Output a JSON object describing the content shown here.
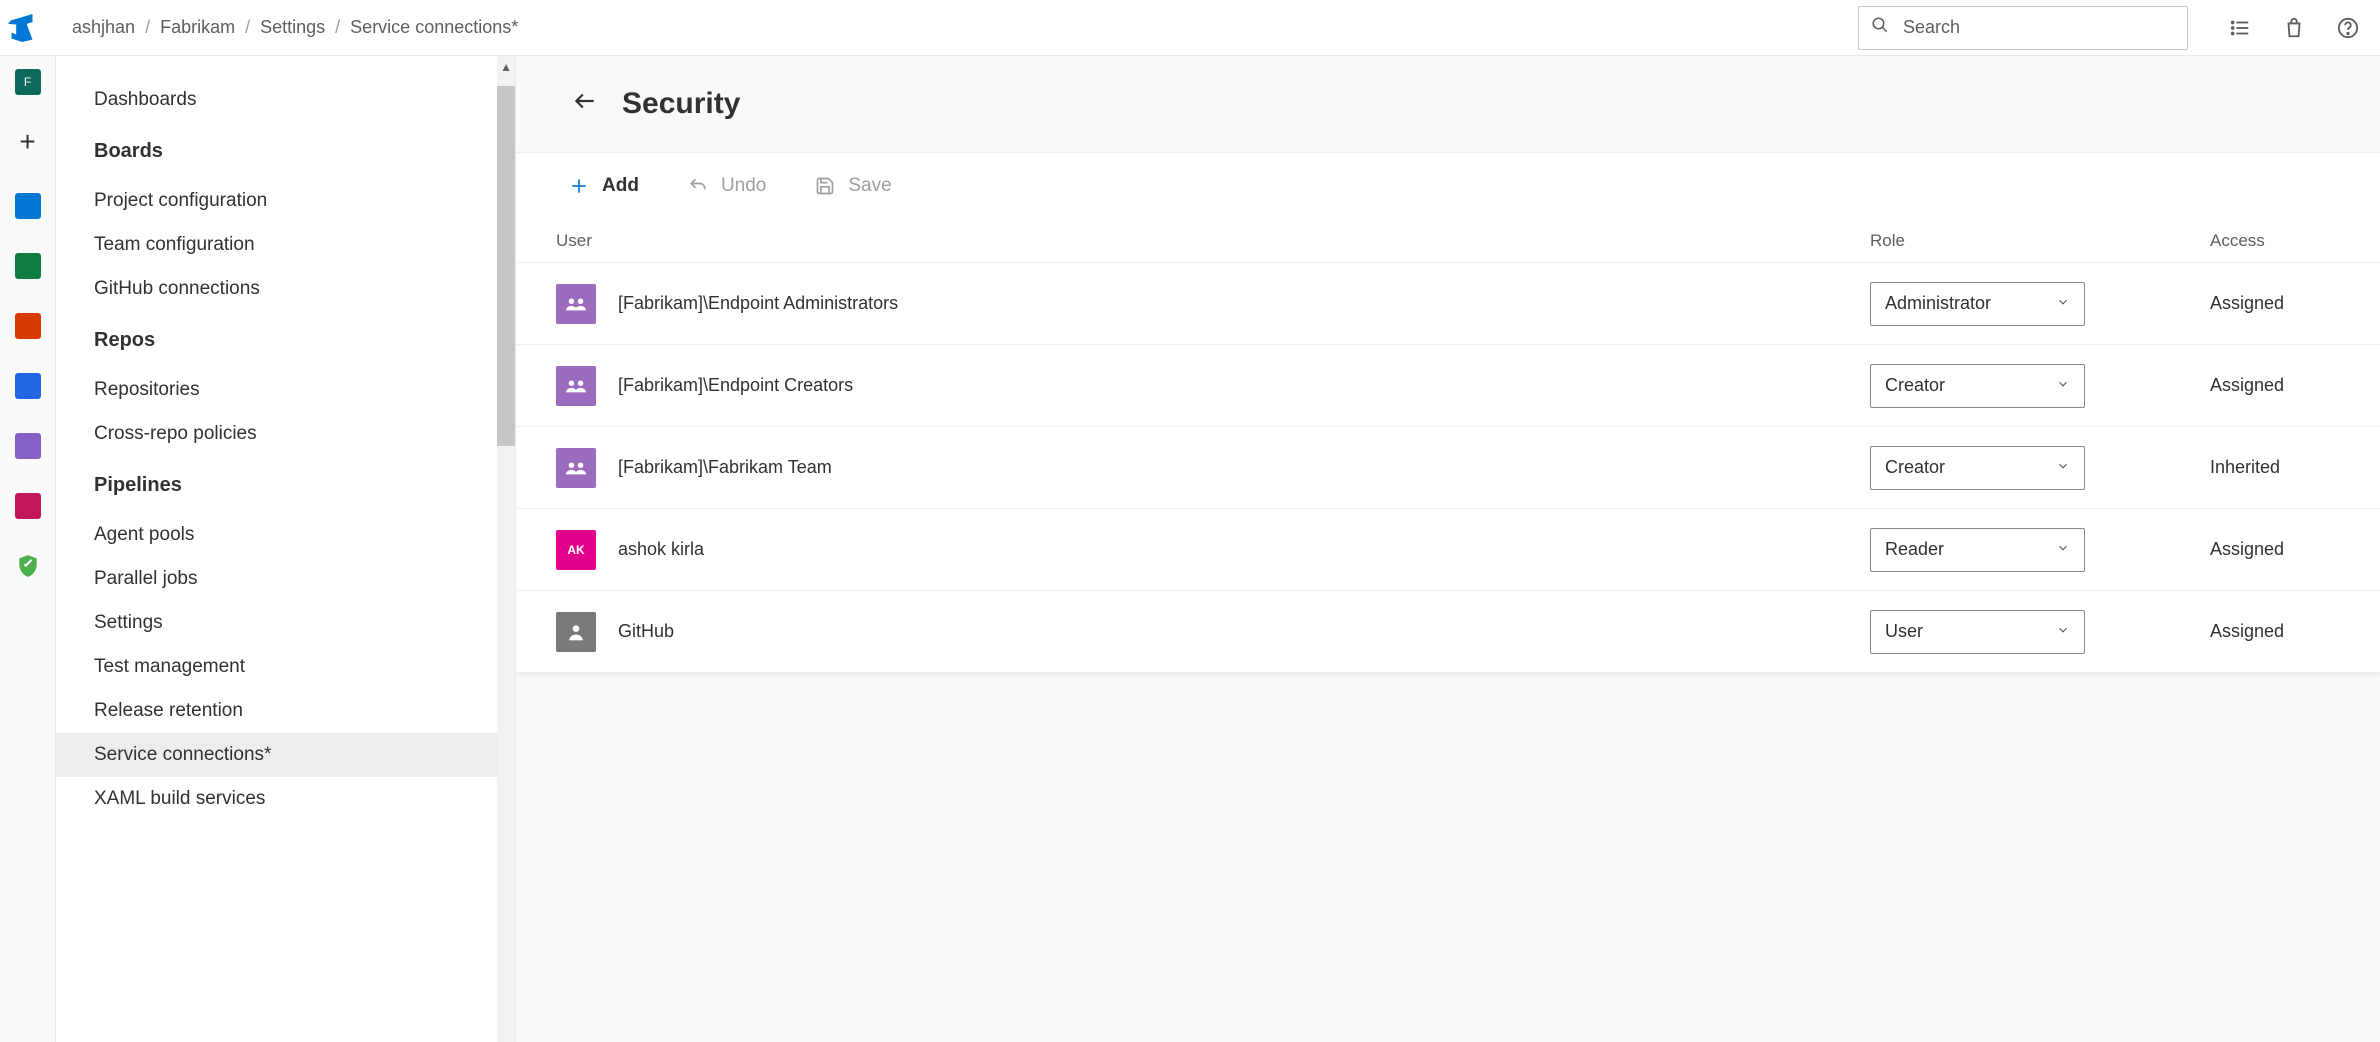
{
  "breadcrumb": [
    "ashjhan",
    "Fabrikam",
    "Settings",
    "Service connections*"
  ],
  "search": {
    "placeholder": "Search"
  },
  "sidebar": {
    "top_item": "Dashboards",
    "sections": [
      {
        "title": "Boards",
        "items": [
          "Project configuration",
          "Team configuration",
          "GitHub connections"
        ]
      },
      {
        "title": "Repos",
        "items": [
          "Repositories",
          "Cross-repo policies"
        ]
      },
      {
        "title": "Pipelines",
        "items": [
          "Agent pools",
          "Parallel jobs",
          "Settings",
          "Test management",
          "Release retention",
          "Service connections*",
          "XAML build services"
        ]
      }
    ],
    "active": "Service connections*"
  },
  "page": {
    "title": "Security"
  },
  "toolbar": {
    "add": "Add",
    "undo": "Undo",
    "save": "Save"
  },
  "table": {
    "headers": {
      "user": "User",
      "role": "Role",
      "access": "Access"
    },
    "rows": [
      {
        "avatar": "group",
        "name": "[Fabrikam]\\Endpoint Administrators",
        "role": "Administrator",
        "access": "Assigned"
      },
      {
        "avatar": "group",
        "name": "[Fabrikam]\\Endpoint Creators",
        "role": "Creator",
        "access": "Assigned"
      },
      {
        "avatar": "group",
        "name": "[Fabrikam]\\Fabrikam Team",
        "role": "Creator",
        "access": "Inherited"
      },
      {
        "avatar": "ak",
        "initials": "AK",
        "name": "ashok kirla",
        "role": "Reader",
        "access": "Assigned"
      },
      {
        "avatar": "gh",
        "name": "GitHub",
        "role": "User",
        "access": "Assigned"
      }
    ]
  }
}
